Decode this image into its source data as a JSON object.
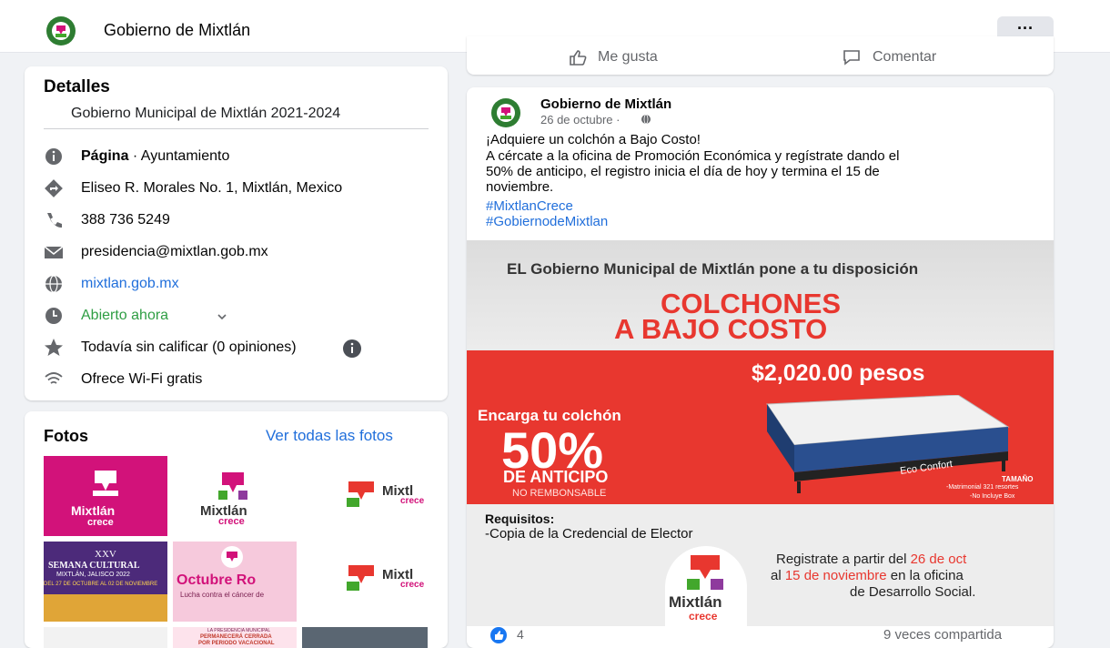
{
  "header": {
    "page_name": "Gobierno de Mixtlán",
    "more_label": "···"
  },
  "details": {
    "title": "Detalles",
    "description": "Gobierno Municipal de Mixtlán 2021-2024",
    "page_type_bold": "Página",
    "page_type_rest": " · Ayuntamiento",
    "address": "Eliseo R. Morales No. 1, Mixtlán, Mexico",
    "phone": "388 736 5249",
    "email": "presidencia@mixtlan.gob.mx",
    "website": "mixtlan.gob.mx",
    "hours": "Abierto ahora",
    "rating": "Todavía sin calificar (0 opiniones)",
    "wifi": "Ofrece Wi-Fi gratis"
  },
  "photos": {
    "title": "Fotos",
    "see_all": "Ver todas las fotos",
    "thumbs": [
      {
        "line1": "Mixtlán",
        "line2": "crece"
      },
      {
        "line1": "Mixtlán",
        "line2": "crece"
      },
      {
        "line1": "Mixtl",
        "line2": "crece"
      },
      {
        "line1": "XXV",
        "line2": "SEMANA CULTURAL",
        "line3": "MIXTLÁN, JALISCO 2022",
        "line4": "DEL 27 DE OCTUBRE AL 02 DE NOVIEMBRE"
      },
      {
        "line1": "Octubre Ro",
        "line2": "Lucha contra el cáncer de"
      },
      {
        "line1": "Mixtl",
        "line2": "crece"
      },
      {
        "line1": "LA PRESIDENCIA MUNICIPAL",
        "line2": "PERMANECERÁ CERRADA",
        "line3": "POR PERIODO VACACIONAL"
      }
    ]
  },
  "prev_post_actions": {
    "like": "Me gusta",
    "comment": "Comentar"
  },
  "post": {
    "author": "Gobierno de Mixtlán",
    "date": "26 de octubre · ",
    "line1": "¡Adquiere un colchón a Bajo Costo!",
    "line2": "A cércate a la oficina de Promoción Económica y regístrate dando el",
    "line3": "50% de anticipo, el registro inicia el día de hoy y termina el 15 de",
    "line4": "noviembre.",
    "hashtag1": "#MixtlanCrece",
    "hashtag2": "#GobiernodeMixtlan",
    "reactions_count": "4",
    "shares": "9 veces compartida"
  },
  "ad": {
    "headline": "EL Gobierno Municipal de Mixtlán pone a tu disposición",
    "title1": "COLCHONES",
    "title2": "A BAJO COSTO",
    "price": "$2,020.00 pesos",
    "order": "Encarga tu colchón",
    "percent": "50%",
    "deposit": "DE ANTICIPO",
    "nonrefund": "NO REMBONSABLE",
    "brand": "Eco Confort",
    "size_title": "TAMAÑO",
    "size1": "-Matrimonial 321 resortes",
    "size2": "-No Incluye Box",
    "req_title": "Requisitos:",
    "req1": "-Copia de la Credencial de Elector",
    "reg1_pre": "Registrate a partir del ",
    "reg1_date": "26 de oct",
    "reg2_pre": "al ",
    "reg2_date": "15 de noviembre",
    "reg2_post": " en la oficina",
    "reg3": "de Desarrollo Social.",
    "logo1": "Mixtlán",
    "logo2": "crece"
  },
  "colors": {
    "accent": "#216fdb",
    "red": "#e8372f",
    "magenta": "#d2127a",
    "green": "#42a72c"
  }
}
